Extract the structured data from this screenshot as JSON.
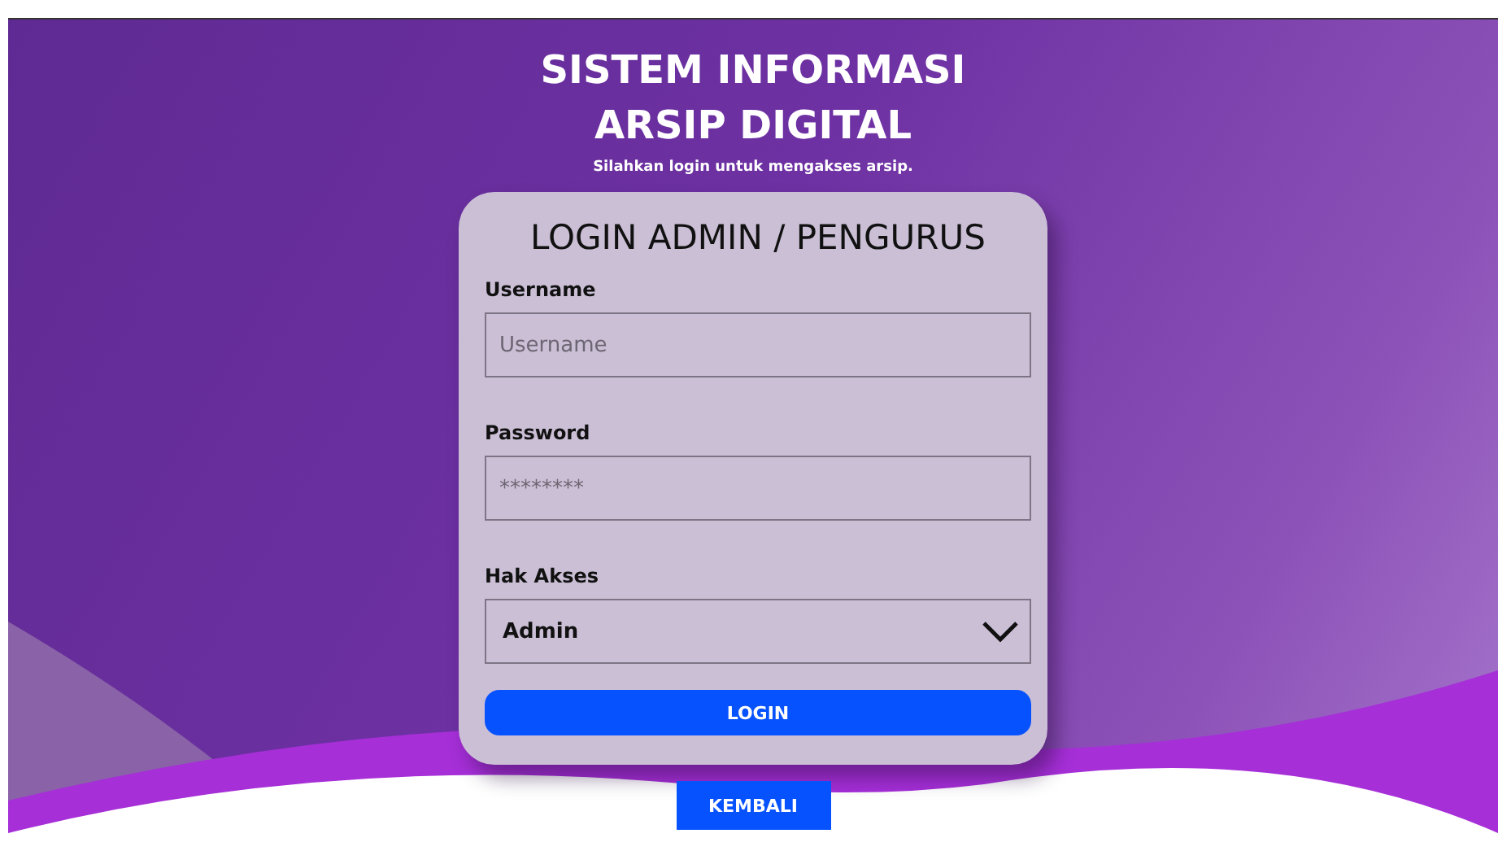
{
  "header": {
    "title_lines": [
      "SISTEM INFORMASI",
      "ARSIP DIGITAL"
    ],
    "subtitle": "Silahkan login untuk mengakses arsip."
  },
  "card": {
    "title": "LOGIN ADMIN / PENGURUS",
    "fields": [
      {
        "kind": "text",
        "label": "Username",
        "placeholder": "Username"
      },
      {
        "kind": "password",
        "label": "Password",
        "placeholder": "********"
      },
      {
        "kind": "select",
        "label": "Hak Akses",
        "value": "Admin"
      }
    ],
    "submit": "LOGIN"
  },
  "back_button": "KEMBALI"
}
